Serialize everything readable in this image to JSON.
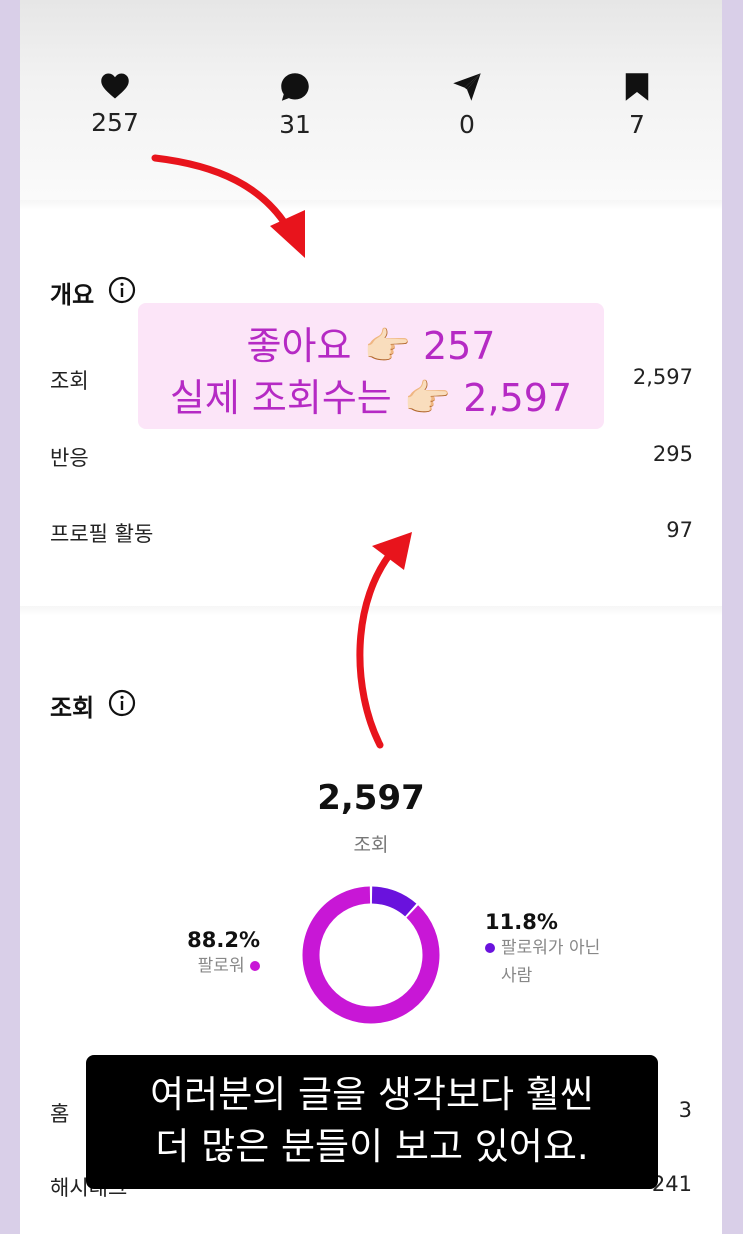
{
  "stats": {
    "likes": "257",
    "comments": "31",
    "shares": "0",
    "saves": "7"
  },
  "overview": {
    "title": "개요",
    "rows": [
      {
        "label": "조회",
        "value": "2,597"
      },
      {
        "label": "반응",
        "value": "295"
      },
      {
        "label": "프로필 활동",
        "value": "97"
      }
    ]
  },
  "views": {
    "title": "조회",
    "total": "2,597",
    "total_label": "조회",
    "followers_pct": "88.2%",
    "followers_label": "팔로워",
    "followers_fraction": 0.882,
    "non_followers_pct": "11.8%",
    "non_followers_label_1": "팔로워가 아닌",
    "non_followers_label_2": "사람",
    "non_followers_fraction": 0.118,
    "bottom_rows": [
      {
        "label": "홈",
        "value": "3"
      },
      {
        "label": "해시태그",
        "value": "241"
      }
    ]
  },
  "overlay": {
    "line1_text": "좋아요",
    "line1_value": "257",
    "line2_text": "실제 조회수는",
    "line2_value": "2,597",
    "emoji": "👉🏻"
  },
  "subtitle": {
    "line1": "여러분의 글을 생각보다 훨씬",
    "line2": "더 많은 분들이 보고 있어요."
  },
  "colors": {
    "followers": "#c817d6",
    "non_followers": "#6a12dd",
    "overlay_text": "#b52ac4",
    "arrow": "#e8141c"
  }
}
